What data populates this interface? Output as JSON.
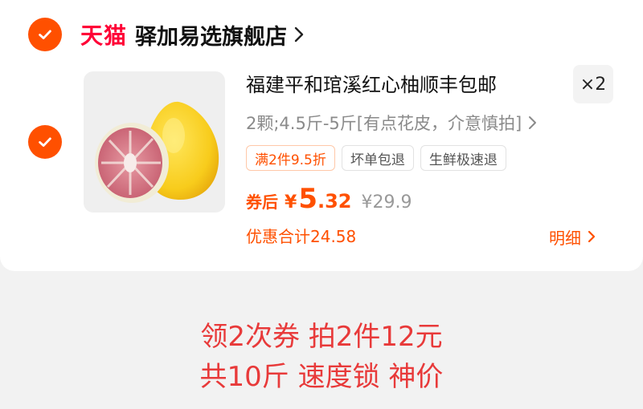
{
  "shop": {
    "platform_logo": "天猫",
    "name": "驿加易选旗舰店",
    "selected": true
  },
  "product": {
    "title": "福建平和琯溪红心柚顺丰包邮",
    "quantity": "×2",
    "sku": "2颗;4.5斤-5斤[有点花皮，介意慎拍]",
    "selected": true,
    "tags": [
      "满2件9.5折",
      "坏单包退",
      "生鲜极速退"
    ],
    "price_label": "券后",
    "price_currency": "¥",
    "price_int": "5",
    "price_dec": ".32",
    "original_price": "¥29.9",
    "discount_total": "优惠合计24.58",
    "detail_label": "明细"
  },
  "overlay": {
    "line1": "领2次券 拍2件12元",
    "line2": "共10斤 速度锁 神价"
  },
  "colors": {
    "accent": "#ff5000",
    "tmall_red": "#ff0036",
    "overlay_text": "#e83a3a"
  }
}
